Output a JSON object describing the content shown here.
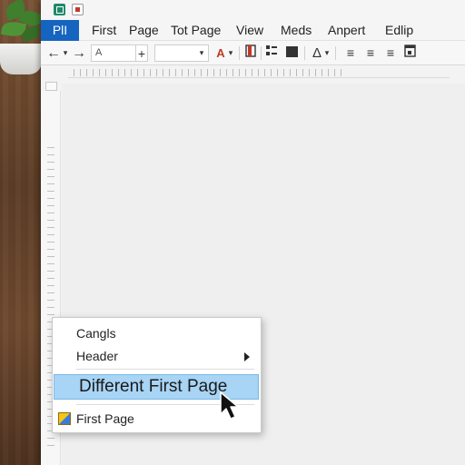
{
  "menubar": {
    "file_tab": "PlI",
    "items": [
      "First",
      "Page",
      "Tot Page",
      "View",
      "Meds",
      "Anpert",
      "Edlip"
    ]
  },
  "toolbar": {
    "font_field": "A",
    "back_icon": "arrow-left-icon",
    "forward_icon": "arrow-right-icon"
  },
  "context_menu": {
    "items": [
      {
        "label": "Cangls"
      },
      {
        "label": "Header",
        "has_submenu": true
      },
      {
        "label": "Different First Page",
        "highlighted": true
      },
      {
        "label": "First Page",
        "icon": "first-page-icon"
      }
    ]
  },
  "colors": {
    "file_tab": "#1565c0",
    "highlight": "#a8d4f5",
    "highlight_border": "#7ab8e6"
  }
}
